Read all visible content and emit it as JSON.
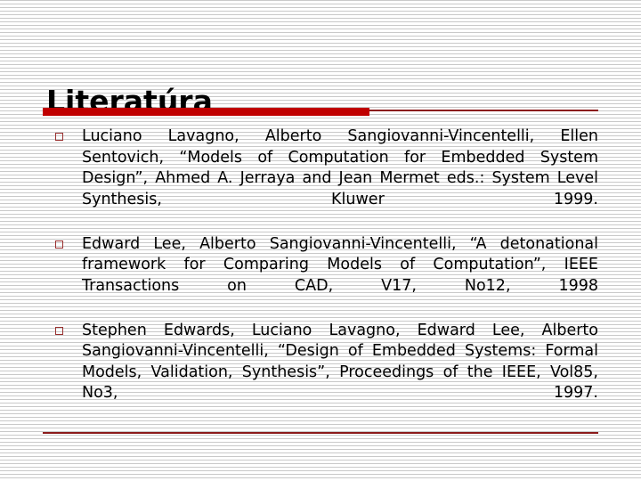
{
  "slide": {
    "title": "Literatúra",
    "accent_color": "#c00000",
    "rule_color": "#8b1a1a",
    "bullet_marker_color": "#99302f",
    "text_color": "#000000",
    "background_color": "#ffffff",
    "background_stripe_color": "#c9c9c9"
  },
  "references": [
    {
      "marker": "square-bullet",
      "text": "Luciano Lavagno, Alberto Sangiovanni-Vincentelli, Ellen Sentovich, “Models of Computation for Embedded System Design”, Ahmed A. Jerraya and Jean Mermet eds.: System Level Synthesis, Kluwer 1999."
    },
    {
      "marker": "square-bullet",
      "text": "Edward Lee, Alberto Sangiovanni-Vincentelli, “A detonational framework for Comparing Models of Computation”, IEEE Transactions on CAD, V17, No12, 1998"
    },
    {
      "marker": "square-bullet",
      "text": "Stephen Edwards, Luciano Lavagno, Edward Lee, Alberto Sangiovanni-Vincentelli, “Design of Embedded Systems: Formal Models, Validation, Synthesis”, Proceedings of the IEEE, Vol85, No3, 1997."
    }
  ]
}
